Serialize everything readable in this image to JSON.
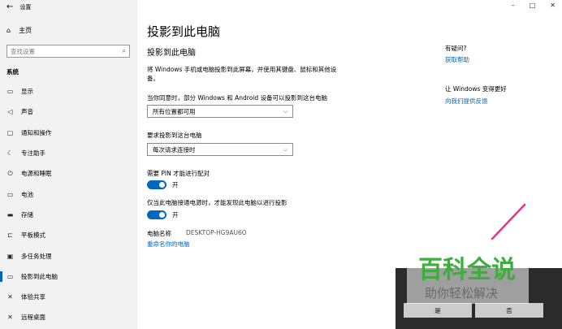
{
  "window": {
    "title": "设置",
    "controls": {
      "minimize": "–",
      "maximize": "□",
      "close": "✕"
    }
  },
  "sidebar": {
    "home_label": "主页",
    "search_placeholder": "查找设置",
    "section_label": "系统",
    "items": [
      {
        "label": "显示",
        "icon": "display-icon",
        "glyph": "▭"
      },
      {
        "label": "声音",
        "icon": "sound-icon",
        "glyph": "◁"
      },
      {
        "label": "通知和操作",
        "icon": "notification-icon",
        "glyph": "▢"
      },
      {
        "label": "专注助手",
        "icon": "focus-assist-icon",
        "glyph": "☾"
      },
      {
        "label": "电源和睡眠",
        "icon": "power-icon",
        "glyph": "⏻"
      },
      {
        "label": "电池",
        "icon": "battery-icon",
        "glyph": "▭"
      },
      {
        "label": "存储",
        "icon": "storage-icon",
        "glyph": "▬"
      },
      {
        "label": "平板模式",
        "icon": "tablet-icon",
        "glyph": "⊏"
      },
      {
        "label": "多任务处理",
        "icon": "multitasking-icon",
        "glyph": "▣"
      },
      {
        "label": "投影到此电脑",
        "icon": "project-icon",
        "glyph": "▭",
        "active": true
      },
      {
        "label": "体验共享",
        "icon": "shared-experiences-icon",
        "glyph": "✕"
      },
      {
        "label": "远程桌面",
        "icon": "remote-desktop-icon",
        "glyph": "✕"
      }
    ]
  },
  "main": {
    "title": "投影到此电脑",
    "section_title": "投影到此电脑",
    "description": "将 Windows 手机或电脑投影到此屏幕，并使用其键盘、鼠标和其他设备。",
    "availability_label": "当你同意时，部分 Windows 和 Android 设备可以投影到这台电脑",
    "availability_value": "所有位置都可用",
    "ask_label": "要求投影到这台电脑",
    "ask_value": "每次请求连接时",
    "pin_label": "需要 PIN 才能进行配对",
    "pin_state": "开",
    "power_label": "仅当此电脑接通电源时，才能发现此电脑以进行投影",
    "power_state": "开",
    "pc_name_label": "电脑名称",
    "pc_name_value": "DESKTOP-HG9AU6O",
    "rename_link": "重命名你的电脑"
  },
  "right": {
    "help_title": "有疑问?",
    "help_link": "获取帮助",
    "improve_title": "让 Windows 变得更好",
    "improve_link": "向我们提供反馈"
  },
  "dialog": {
    "yes_button": "是",
    "no_button": "否"
  },
  "watermark": {
    "brand": "百科全说",
    "tagline": "助你轻松解决"
  },
  "colors": {
    "accent": "#0067c0",
    "sidebar_bg": "#f2f2f2",
    "watermark_green": "#3cae3c"
  }
}
